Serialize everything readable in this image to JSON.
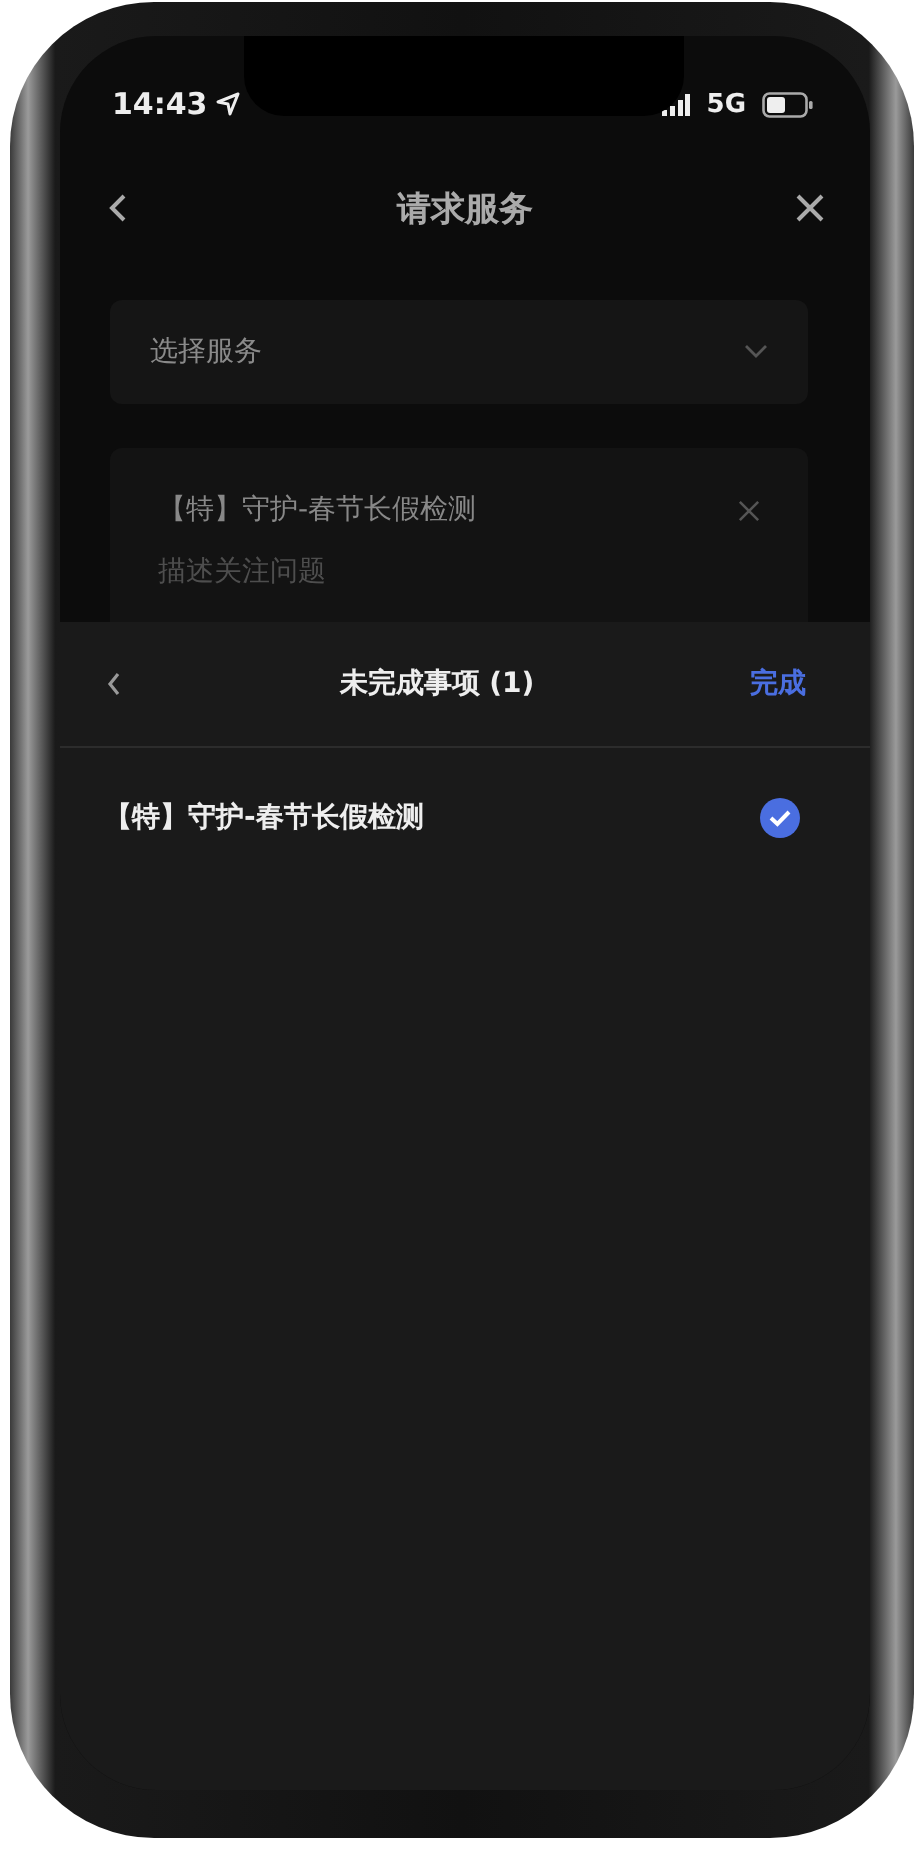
{
  "status_bar": {
    "time": "14:43",
    "network": "5G"
  },
  "nav": {
    "title": "请求服务"
  },
  "form": {
    "select": {
      "placeholder": "选择服务"
    },
    "service_card": {
      "title": "【特】守护-春节长假检测",
      "description": {
        "placeholder": "描述关注问题"
      }
    }
  },
  "sheet": {
    "title": "未完成事项 (1)",
    "done": "完成",
    "items": [
      {
        "label": "【特】守护-春节长假检测",
        "selected": true
      }
    ]
  }
}
